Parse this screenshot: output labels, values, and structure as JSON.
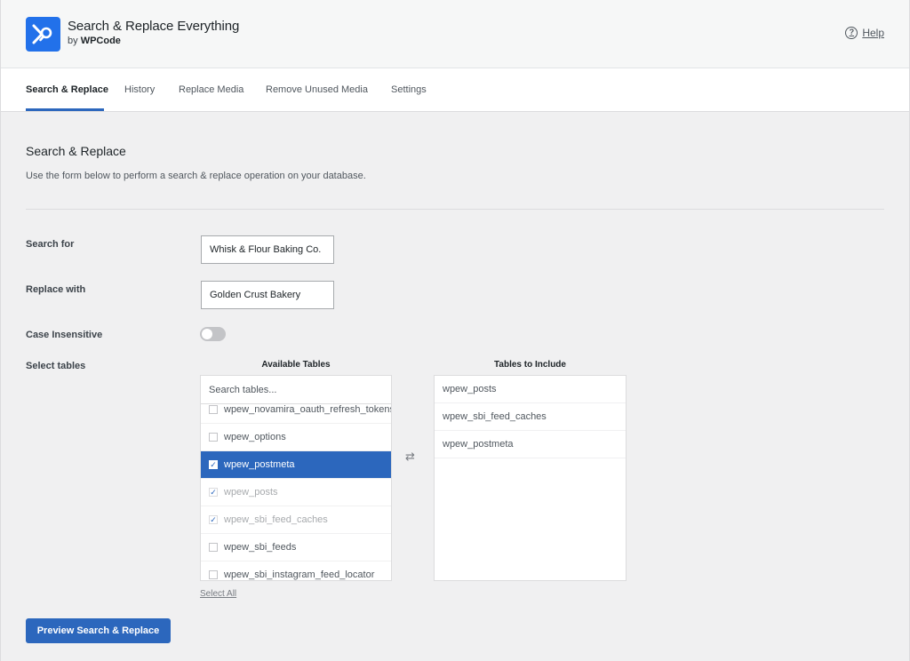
{
  "header": {
    "brand_title": "Search & Replace Everything",
    "brand_by": "by",
    "brand_company": "WPCode",
    "help_label": "Help",
    "accent_color": "#2271ea"
  },
  "tabs": [
    {
      "label": "Search & Replace",
      "active": true
    },
    {
      "label": "History"
    },
    {
      "label": "Replace Media"
    },
    {
      "label": "Remove Unused Media"
    },
    {
      "label": "Settings"
    }
  ],
  "section": {
    "title": "Search & Replace",
    "description": "Use the form below to perform a search & replace operation on your database."
  },
  "form": {
    "search_label": "Search for",
    "search_value": "Whisk & Flour Baking Co.",
    "replace_label": "Replace with",
    "replace_value": "Golden Crust Bakery",
    "case_label": "Case Insensitive",
    "case_insensitive": false,
    "tables_label": "Select tables"
  },
  "available_tables": {
    "header": "Available Tables",
    "search_placeholder": "Search tables...",
    "items": [
      {
        "name": "wpew_novamira_oauth_refresh_tokens",
        "state": "unchecked"
      },
      {
        "name": "wpew_options",
        "state": "unchecked"
      },
      {
        "name": "wpew_postmeta",
        "state": "selected"
      },
      {
        "name": "wpew_posts",
        "state": "included"
      },
      {
        "name": "wpew_sbi_feed_caches",
        "state": "included"
      },
      {
        "name": "wpew_sbi_feeds",
        "state": "unchecked"
      },
      {
        "name": "wpew_sbi_instagram_feed_locator",
        "state": "unchecked"
      }
    ],
    "select_all": "Select All"
  },
  "included_tables": {
    "header": "Tables to Include",
    "items": [
      "wpew_posts",
      "wpew_sbi_feed_caches",
      "wpew_postmeta"
    ]
  },
  "actions": {
    "preview_label": "Preview Search & Replace",
    "button_color": "#2c67bd"
  },
  "icons": {
    "logo": "search-replace-logo-icon",
    "help": "question-circle-icon",
    "swap": "swap-arrows-icon",
    "check": "checkmark-icon"
  }
}
